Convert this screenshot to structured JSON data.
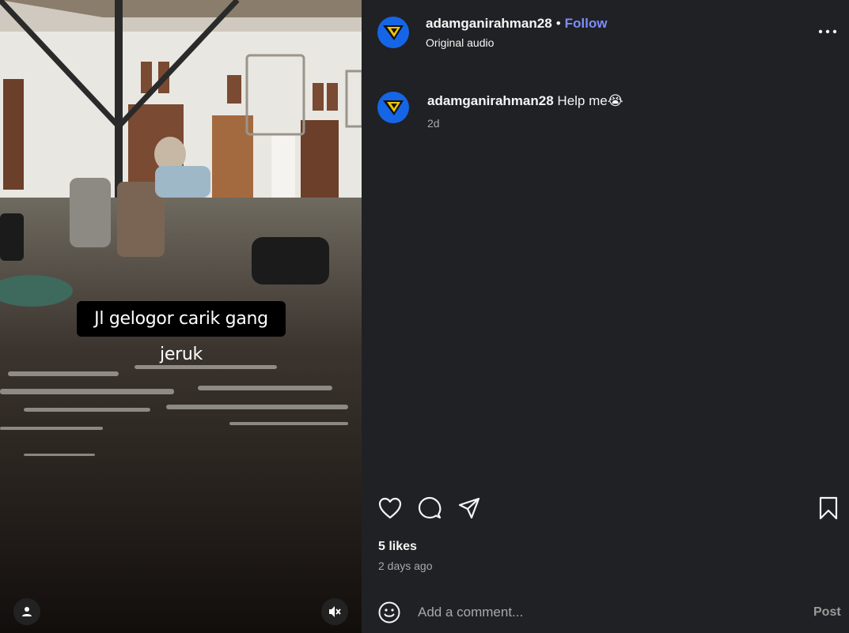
{
  "media": {
    "overlay_text": "Jl gelogor carik gang jeruk",
    "tag_icon": "user-icon",
    "mute_icon": "speaker-muted-icon"
  },
  "header": {
    "username": "adamganirahman28",
    "separator": "•",
    "follow_label": "Follow",
    "audio": "Original audio",
    "more_icon": "more-options-icon"
  },
  "caption": {
    "username": "adamganirahman28",
    "text": "Help me",
    "emoji": "😭",
    "time": "2d"
  },
  "actions": {
    "like_icon": "heart-icon",
    "comment_icon": "comment-icon",
    "share_icon": "share-icon",
    "save_icon": "bookmark-icon"
  },
  "likes": "5 likes",
  "date": "2 days ago",
  "comment_box": {
    "placeholder": "Add a comment...",
    "post_label": "Post",
    "emoji_icon": "smiley-icon"
  },
  "colors": {
    "panel_bg": "#202124",
    "follow": "#7d8cff",
    "avatar_bg": "#1565e6",
    "muted_text": "#a8a8a8"
  }
}
